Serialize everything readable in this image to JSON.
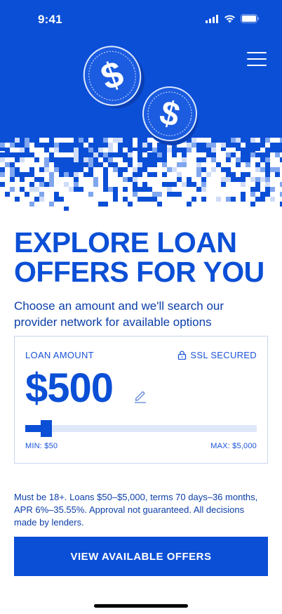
{
  "status_bar": {
    "time": "9:41",
    "icons": [
      "cellular-signal-icon",
      "wifi-icon",
      "battery-icon"
    ]
  },
  "header": {
    "menu_icon": "hamburger-menu-icon",
    "hero_art": "pixelated-dollar-coins-illustration"
  },
  "hero": {
    "title_line1": "EXPLORE LOAN",
    "title_line2": "OFFERS FOR YOU",
    "subtitle": "Choose an amount and we'll search our provider network for available options"
  },
  "loan_card": {
    "label": "LOAN AMOUNT",
    "ssl_label": "SSL SECURED",
    "amount": "$500",
    "slider": {
      "min": 50,
      "max": 5000,
      "value": 500
    },
    "min_label": "MIN: $50",
    "max_label": "MAX: $5,000"
  },
  "disclaimer": "Must be 18+. Loans $50–$5,000, terms 70 days–36 months, APR 6%–35.55%. Approval not guaranteed. All decisions made by lenders.",
  "cta": {
    "label": "VIEW AVAILABLE OFFERS"
  },
  "colors": {
    "brand_blue": "#0b4fd6",
    "dark_text": "#0b3ea8",
    "slider_track": "#dfe8f8",
    "card_border": "#c9d6ef"
  }
}
